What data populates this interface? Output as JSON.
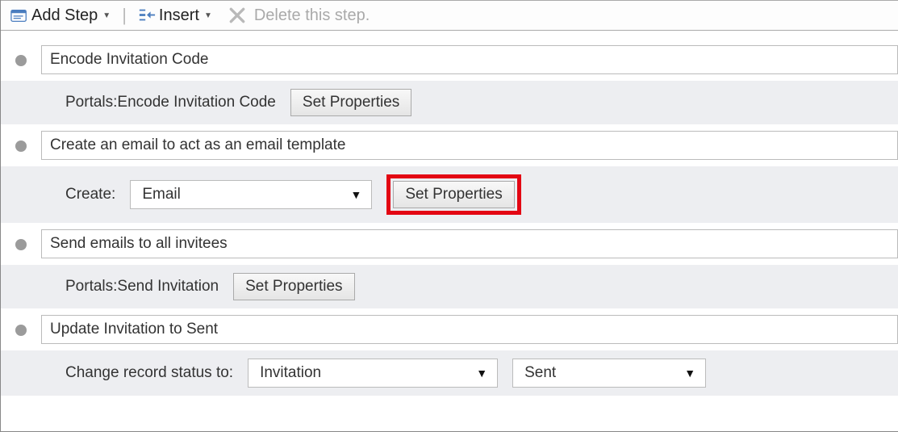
{
  "toolbar": {
    "add_step": "Add Step",
    "insert": "Insert",
    "delete_step": "Delete this step."
  },
  "common": {
    "set_properties": "Set Properties"
  },
  "steps": {
    "s1": {
      "title": "Encode Invitation Code",
      "detail_label": "Portals:Encode Invitation Code"
    },
    "s2": {
      "title": "Create an email to act as an email template",
      "create_label": "Create:",
      "create_value": "Email"
    },
    "s3": {
      "title": "Send emails to all invitees",
      "detail_label": "Portals:Send Invitation"
    },
    "s4": {
      "title": "Update Invitation to Sent",
      "change_label": "Change record status to:",
      "status_entity": "Invitation",
      "status_value": "Sent"
    }
  }
}
